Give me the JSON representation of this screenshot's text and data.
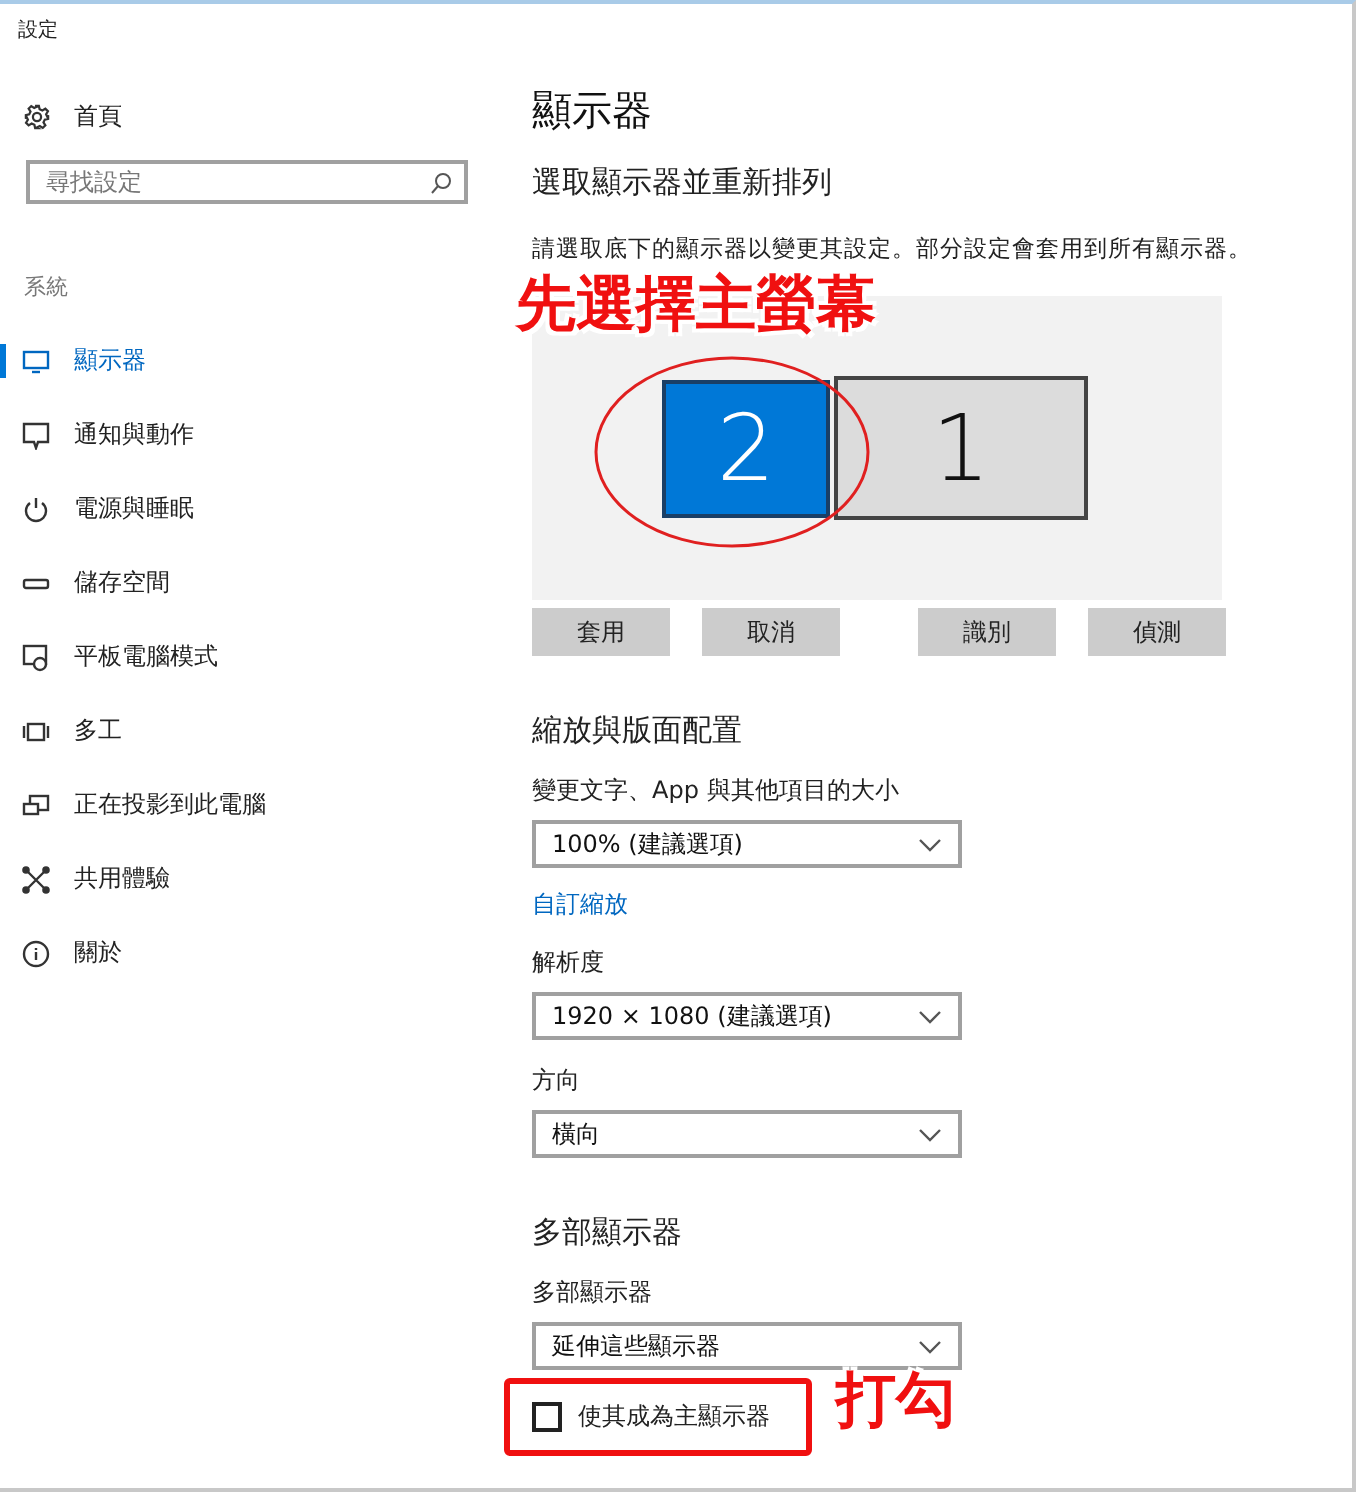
{
  "window": {
    "title": "設定"
  },
  "sidebar": {
    "home": {
      "label": "首頁"
    },
    "search": {
      "placeholder": "尋找設定"
    },
    "section_label": "系統",
    "items": [
      {
        "label": "顯示器",
        "selected": true
      },
      {
        "label": "通知與動作",
        "selected": false
      },
      {
        "label": "電源與睡眠",
        "selected": false
      },
      {
        "label": "儲存空間",
        "selected": false
      },
      {
        "label": "平板電腦模式",
        "selected": false
      },
      {
        "label": "多工",
        "selected": false
      },
      {
        "label": "正在投影到此電腦",
        "selected": false
      },
      {
        "label": "共用體驗",
        "selected": false
      },
      {
        "label": "關於",
        "selected": false
      }
    ]
  },
  "content": {
    "title": "顯示器",
    "arrange_heading": "選取顯示器並重新排列",
    "description": "請選取底下的顯示器以變更其設定。部分設定會套用到所有顯示器。",
    "monitors": [
      {
        "label": "2",
        "selected": true
      },
      {
        "label": "1",
        "selected": false
      }
    ],
    "arrange_buttons": [
      {
        "label": "套用"
      },
      {
        "label": "取消"
      },
      {
        "label": "識別"
      },
      {
        "label": "偵測"
      }
    ],
    "settings": [
      {
        "kind": "heading",
        "text": "縮放與版面配置"
      },
      {
        "kind": "label",
        "text": "變更文字、App 與其他項目的大小"
      },
      {
        "kind": "dropdown",
        "value": "100% (建議選項)"
      },
      {
        "kind": "link",
        "text": "自訂縮放"
      },
      {
        "kind": "label",
        "text": "解析度"
      },
      {
        "kind": "dropdown",
        "value": "1920 × 1080 (建議選項)"
      },
      {
        "kind": "label",
        "text": "方向"
      },
      {
        "kind": "dropdown",
        "value": "橫向"
      },
      {
        "kind": "heading",
        "text": "多部顯示器"
      },
      {
        "kind": "label",
        "text": "多部顯示器"
      },
      {
        "kind": "dropdown",
        "value": "延伸這些顯示器"
      },
      {
        "kind": "checkbox",
        "text": "使其成為主顯示器",
        "checked": false
      }
    ]
  },
  "annotations": [
    {
      "text": "先選擇主螢幕"
    },
    {
      "text": "打勾"
    }
  ]
}
